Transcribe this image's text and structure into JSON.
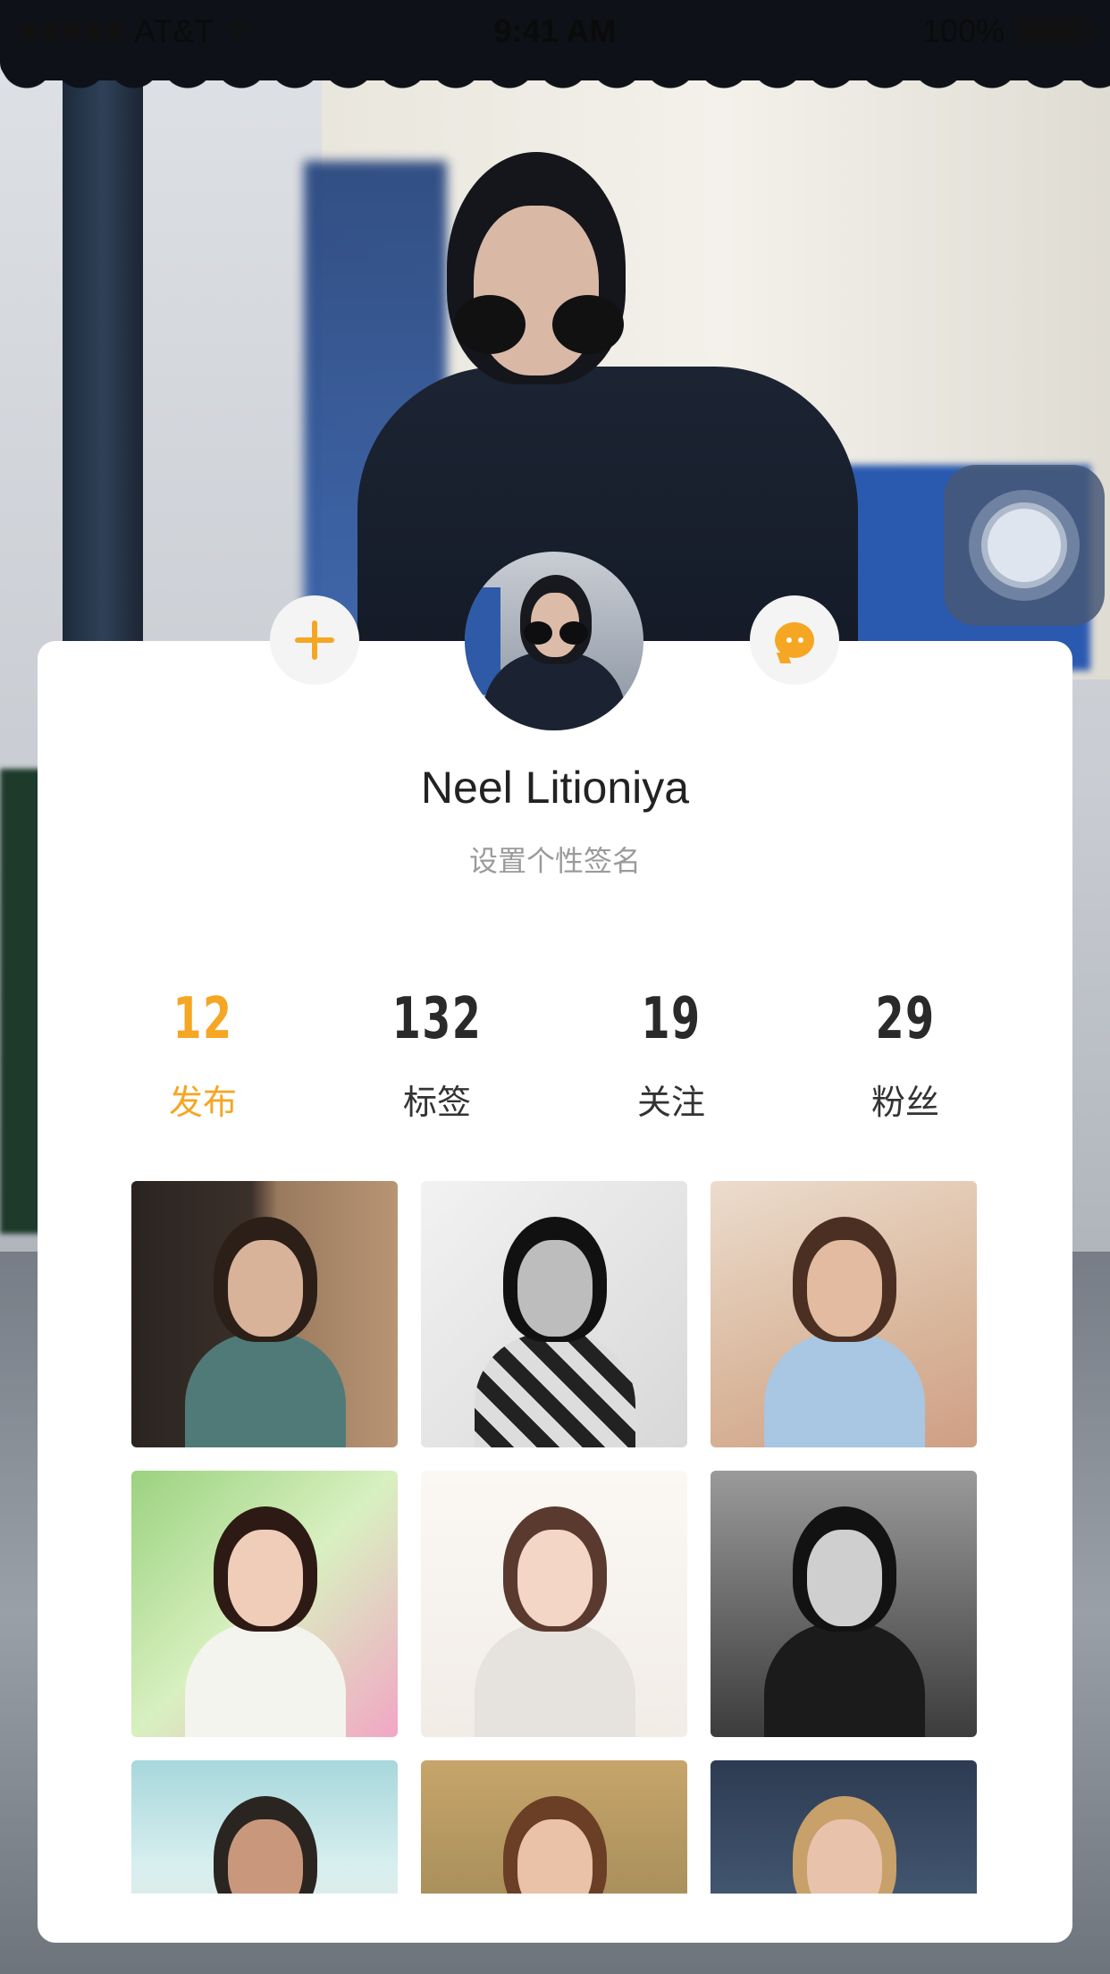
{
  "status_bar": {
    "carrier": "AT&T",
    "time": "9:41 AM",
    "battery": "100%"
  },
  "profile": {
    "name": "Neel Litioniya",
    "signature": "设置个性签名"
  },
  "stats": [
    {
      "value": "12",
      "label": "发布",
      "active": true
    },
    {
      "value": "132",
      "label": "标签",
      "active": false
    },
    {
      "value": "19",
      "label": "关注",
      "active": false
    },
    {
      "value": "29",
      "label": "粉丝",
      "active": false
    }
  ],
  "accent_color": "#f5a623",
  "photos": [
    {
      "theme": "brick-wall-backpack"
    },
    {
      "theme": "bw-plaid-portrait"
    },
    {
      "theme": "short-hair-hoodie"
    },
    {
      "theme": "green-flower-portrait"
    },
    {
      "theme": "white-sweater-portrait"
    },
    {
      "theme": "bw-suit-portrait"
    },
    {
      "theme": "beach-father-child"
    },
    {
      "theme": "girl-with-rabbit"
    },
    {
      "theme": "blonde-girl"
    }
  ]
}
